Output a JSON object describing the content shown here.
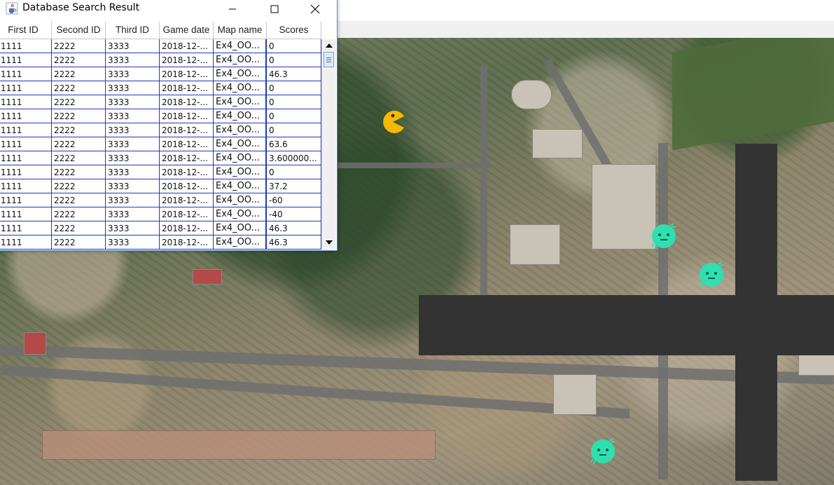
{
  "dialog": {
    "title": "Database Search Result",
    "columns": [
      "First ID",
      "Second ID",
      "Third ID",
      "Game date",
      "Map name",
      "Scores"
    ],
    "rows": [
      [
        "1111",
        "2222",
        "3333",
        "2018-12-...",
        "Ex4_OO...",
        "0"
      ],
      [
        "1111",
        "2222",
        "3333",
        "2018-12-...",
        "Ex4_OO...",
        "0"
      ],
      [
        "1111",
        "2222",
        "3333",
        "2018-12-...",
        "Ex4_OO...",
        "46.3"
      ],
      [
        "1111",
        "2222",
        "3333",
        "2018-12-...",
        "Ex4_OO...",
        "0"
      ],
      [
        "1111",
        "2222",
        "3333",
        "2018-12-...",
        "Ex4_OO...",
        "0"
      ],
      [
        "1111",
        "2222",
        "3333",
        "2018-12-...",
        "Ex4_OO...",
        "0"
      ],
      [
        "1111",
        "2222",
        "3333",
        "2018-12-...",
        "Ex4_OO...",
        "0"
      ],
      [
        "1111",
        "2222",
        "3333",
        "2018-12-...",
        "Ex4_OO...",
        "63.6"
      ],
      [
        "1111",
        "2222",
        "3333",
        "2018-12-...",
        "Ex4_OO...",
        "3.600000..."
      ],
      [
        "1111",
        "2222",
        "3333",
        "2018-12-...",
        "Ex4_OO...",
        "0"
      ],
      [
        "1111",
        "2222",
        "3333",
        "2018-12-...",
        "Ex4_OO...",
        "37.2"
      ],
      [
        "1111",
        "2222",
        "3333",
        "2018-12-...",
        "Ex4_OO...",
        "-60"
      ],
      [
        "1111",
        "2222",
        "3333",
        "2018-12-...",
        "Ex4_OO...",
        "-40"
      ],
      [
        "1111",
        "2222",
        "3333",
        "2018-12-...",
        "Ex4_OO...",
        "46.3"
      ],
      [
        "1111",
        "2222",
        "3333",
        "2018-12-...",
        "Ex4_OO...",
        "46.3"
      ]
    ],
    "icons": {
      "app": "java-cup-icon",
      "minimize": "minimize-icon",
      "maximize": "maximize-icon",
      "close": "close-icon"
    }
  },
  "game": {
    "player": "pacman",
    "ghost_count": 3,
    "colors": {
      "pacman": "#f5b800",
      "ghost": "#2ee0b0",
      "wall": "#333333"
    }
  }
}
